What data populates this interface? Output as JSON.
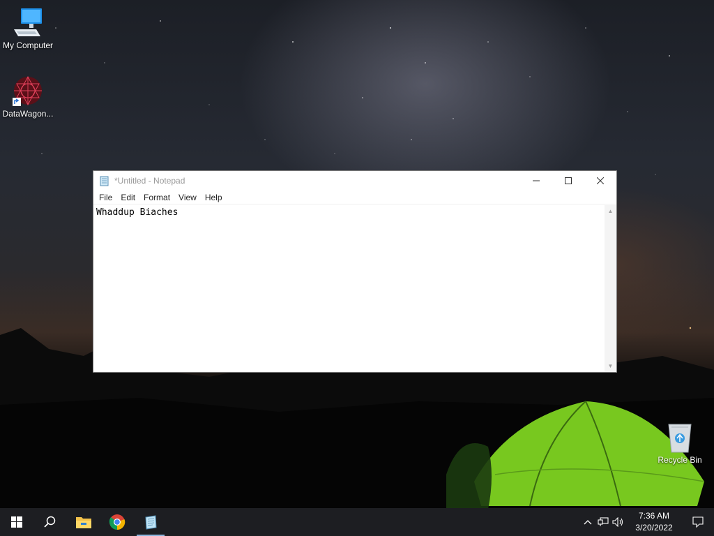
{
  "desktop": {
    "icons": [
      {
        "label": "My Computer",
        "icon": "computer-icon"
      },
      {
        "label": "DataWagon...",
        "icon": "datawagon-icon"
      },
      {
        "label": "Recycle Bin",
        "icon": "recycle-bin-icon"
      }
    ]
  },
  "notepad": {
    "title": "*Untitled - Notepad",
    "menu": [
      "File",
      "Edit",
      "Format",
      "View",
      "Help"
    ],
    "content": "Whaddup Biaches",
    "controls": {
      "minimize": "minimize-icon",
      "maximize": "maximize-icon",
      "close": "close-icon"
    }
  },
  "taskbar": {
    "items": [
      "start-icon",
      "search-icon",
      "file-explorer-icon",
      "chrome-icon",
      "notepad-icon"
    ],
    "active": "notepad-icon",
    "tray": [
      "chevron-up-icon",
      "network-icon",
      "volume-icon"
    ],
    "time": "7:36 AM",
    "date": "3/20/2022",
    "notification_icon": "notification-icon"
  },
  "colors": {
    "taskbar_bg": "#1d1e22",
    "active_indicator": "#8ab4dc",
    "tent_green": "#7ed321"
  }
}
